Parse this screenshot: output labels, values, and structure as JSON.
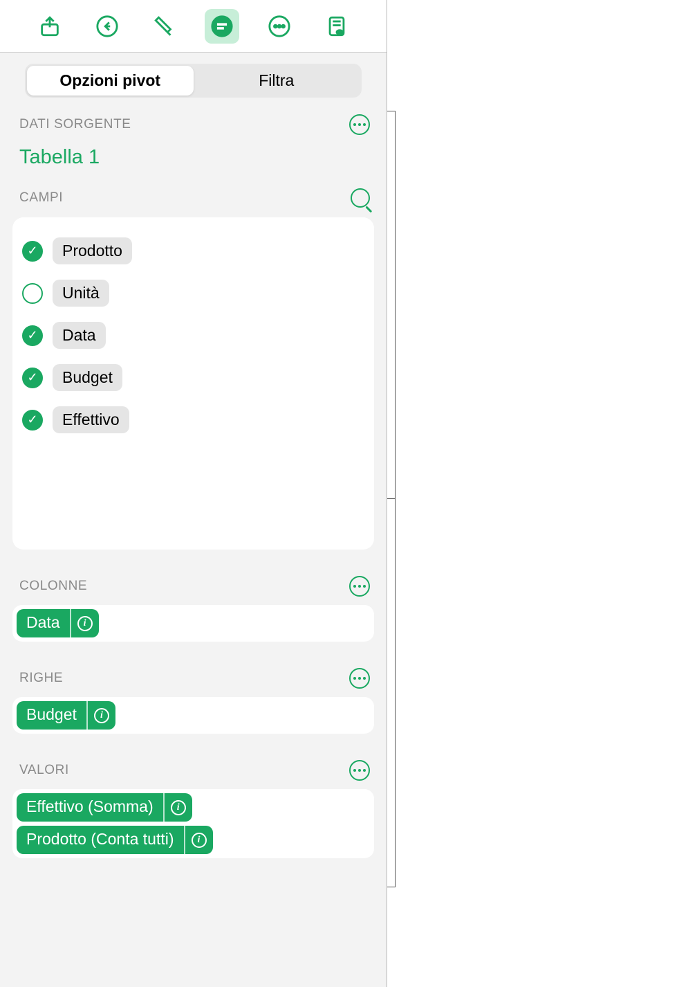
{
  "tabs": {
    "pivot": "Opzioni pivot",
    "filter": "Filtra"
  },
  "sections": {
    "source": "DATI SORGENTE",
    "fields": "CAMPI",
    "cols": "COLONNE",
    "rows": "RIGHE",
    "vals": "VALORI"
  },
  "source_name": "Tabella 1",
  "fields": [
    {
      "label": "Prodotto",
      "checked": true
    },
    {
      "label": "Unità",
      "checked": false
    },
    {
      "label": "Data",
      "checked": true
    },
    {
      "label": "Budget",
      "checked": true
    },
    {
      "label": "Effettivo",
      "checked": true
    }
  ],
  "columns": [
    {
      "label": "Data"
    }
  ],
  "rows": [
    {
      "label": "Budget"
    }
  ],
  "values": [
    {
      "label": "Effettivo (Somma)"
    },
    {
      "label": "Prodotto (Conta tutti)"
    }
  ]
}
